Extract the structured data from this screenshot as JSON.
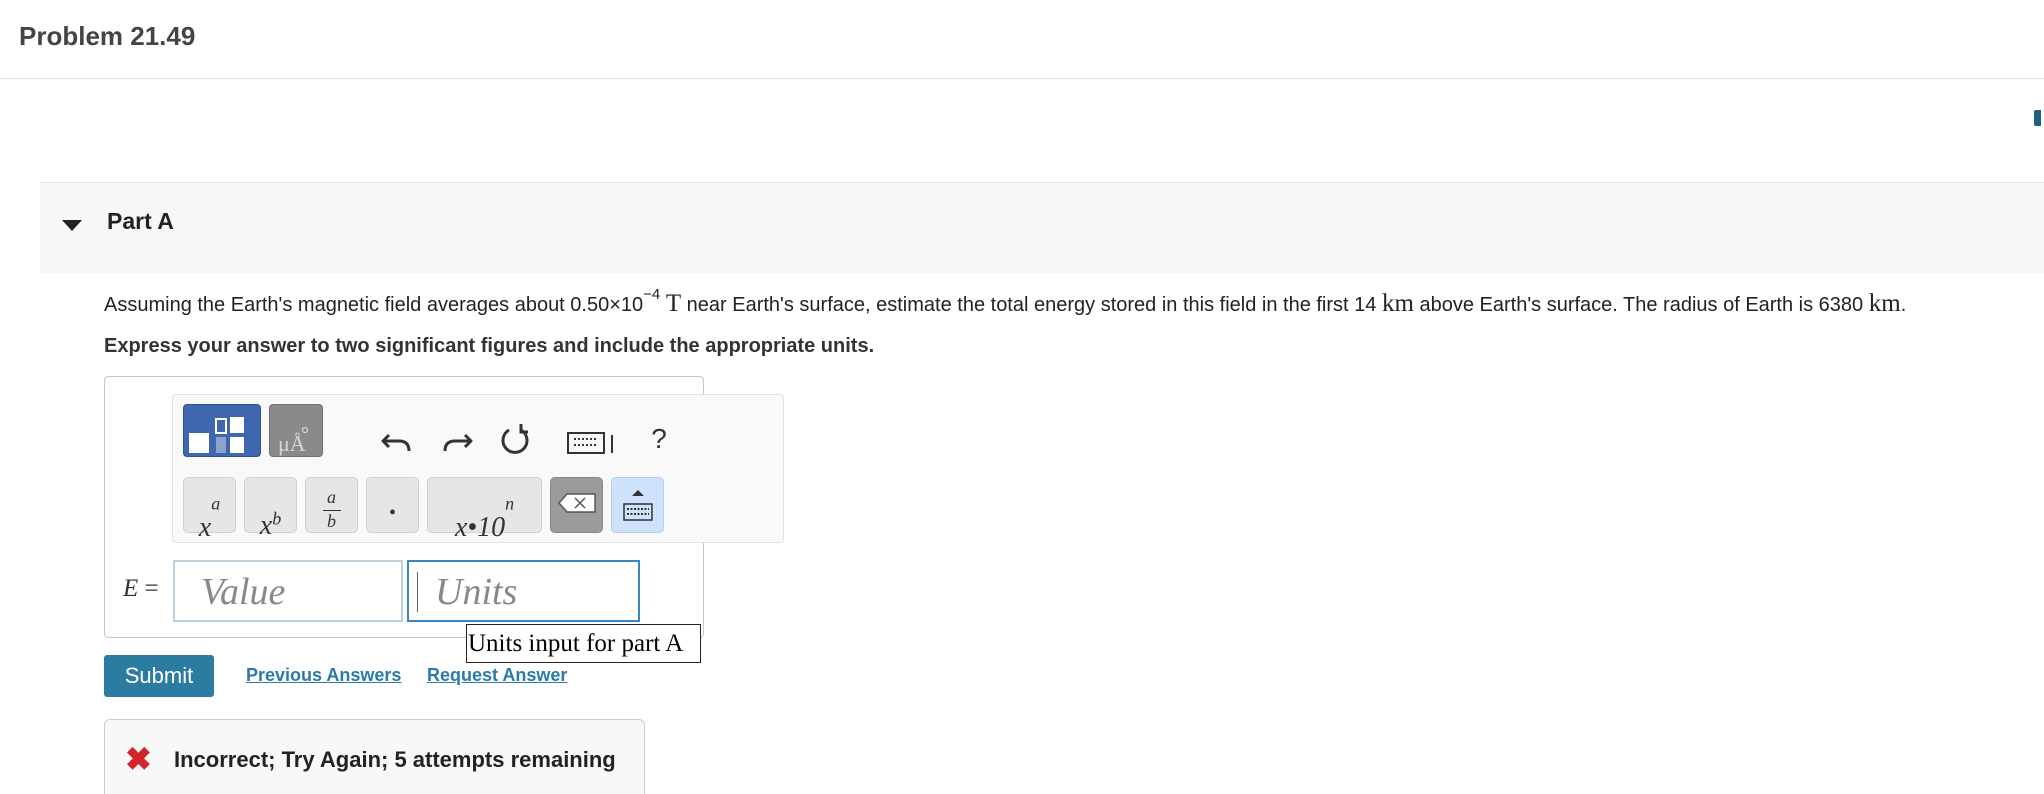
{
  "page": {
    "title": "Problem 21.49"
  },
  "part": {
    "label": "Part A"
  },
  "question": {
    "intro": "Assuming the Earth's magnetic field averages about 0.50×10",
    "exponent": "−4",
    "unit_t": "T",
    "middle": " near Earth's surface, estimate the total energy stored in this field in the first 14 ",
    "unit_km": "km",
    "end": " above Earth's surface. The radius of Earth is 6380 ",
    "unit_km2": "km",
    "period": ".",
    "instruction": "Express your answer to two significant figures and include the appropriate units."
  },
  "toolbar": {
    "templates_icon": "templates-icon",
    "symbols_icon": "symbols-icon",
    "symbols_label": "μÅ",
    "undo_icon": "undo-icon",
    "redo_icon": "redo-icon",
    "reset_icon": "reset-icon",
    "keyboard_icon": "keyboard-icon",
    "help_label": "?",
    "keys": {
      "superscript_base": "x",
      "superscript_exp": "a",
      "subscript_base": "x",
      "subscript_sub": "b",
      "fraction_num": "a",
      "fraction_den": "b",
      "decimal": "•",
      "sci_notation_base": "x•10",
      "sci_notation_exp": "n"
    }
  },
  "answer": {
    "variable": "E",
    "equals": "=",
    "value_placeholder": "Value",
    "units_placeholder": "Units",
    "tooltip": "Units input for part A"
  },
  "actions": {
    "submit": "Submit",
    "previous_answers": "Previous Answers",
    "request_answer": "Request Answer"
  },
  "feedback": {
    "message": "Incorrect; Try Again; 5 attempts remaining"
  },
  "colors": {
    "submit_bg": "#2c7ca2",
    "link": "#2b7aa8",
    "error": "#d0252b",
    "templates_btn": "#3f67b0"
  }
}
